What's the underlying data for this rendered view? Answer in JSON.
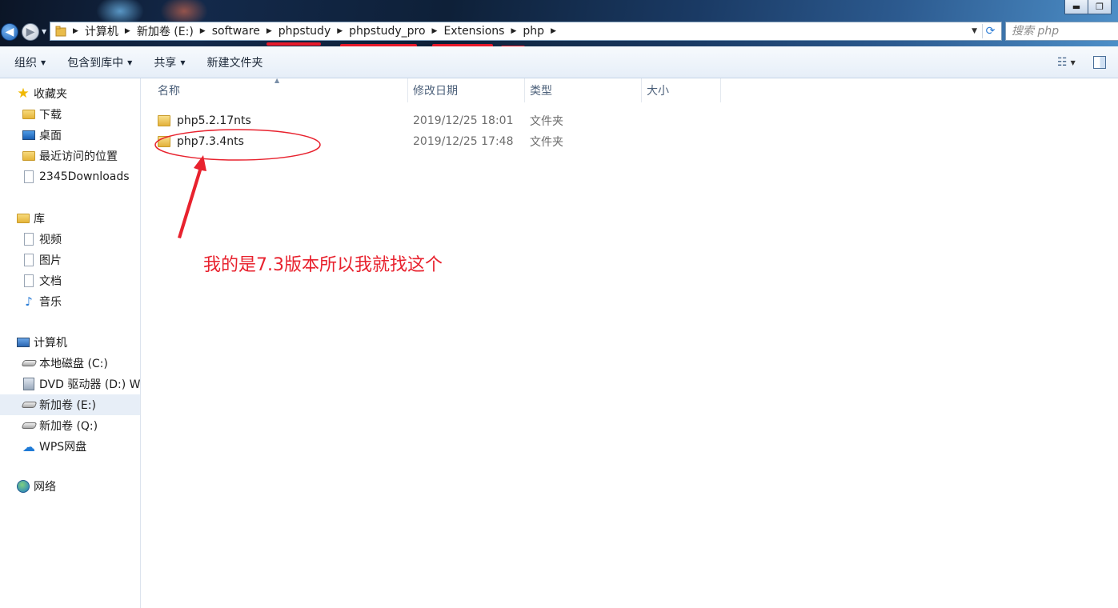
{
  "window": {
    "minimize_glyph": "▬",
    "maximize_glyph": "❐"
  },
  "address": {
    "breadcrumbs": [
      "计算机",
      "新加卷 (E:)",
      "software",
      "phpstudy",
      "phpstudy_pro",
      "Extensions",
      "php"
    ],
    "search_placeholder": "搜索 php"
  },
  "toolbar": {
    "organize": "组织",
    "include_in_library": "包含到库中",
    "share": "共享",
    "new_folder": "新建文件夹"
  },
  "sidebar": {
    "favorites": {
      "label": "收藏夹",
      "items": [
        "下载",
        "桌面",
        "最近访问的位置",
        "2345Downloads"
      ]
    },
    "libraries": {
      "label": "库",
      "items": [
        "视频",
        "图片",
        "文档",
        "音乐"
      ]
    },
    "computer": {
      "label": "计算机",
      "items": [
        "本地磁盘 (C:)",
        "DVD 驱动器 (D:) Win",
        "新加卷 (E:)",
        "新加卷 (Q:)",
        "WPS网盘"
      ]
    },
    "network": {
      "label": "网络"
    },
    "selected_item": "新加卷 (E:)"
  },
  "file_list": {
    "columns": [
      "名称",
      "修改日期",
      "类型",
      "大小"
    ],
    "rows": [
      {
        "name": "php5.2.17nts",
        "modified": "2019/12/25 18:01",
        "type": "文件夹"
      },
      {
        "name": "php7.3.4nts",
        "modified": "2019/12/25 17:48",
        "type": "文件夹"
      }
    ]
  },
  "annotation": {
    "text": "我的是7.3版本所以我就找这个",
    "color": "#e8222e"
  },
  "colors": {
    "accent": "#2a7cd6",
    "selection": "#e7eef7",
    "annotation": "#e8222e"
  }
}
